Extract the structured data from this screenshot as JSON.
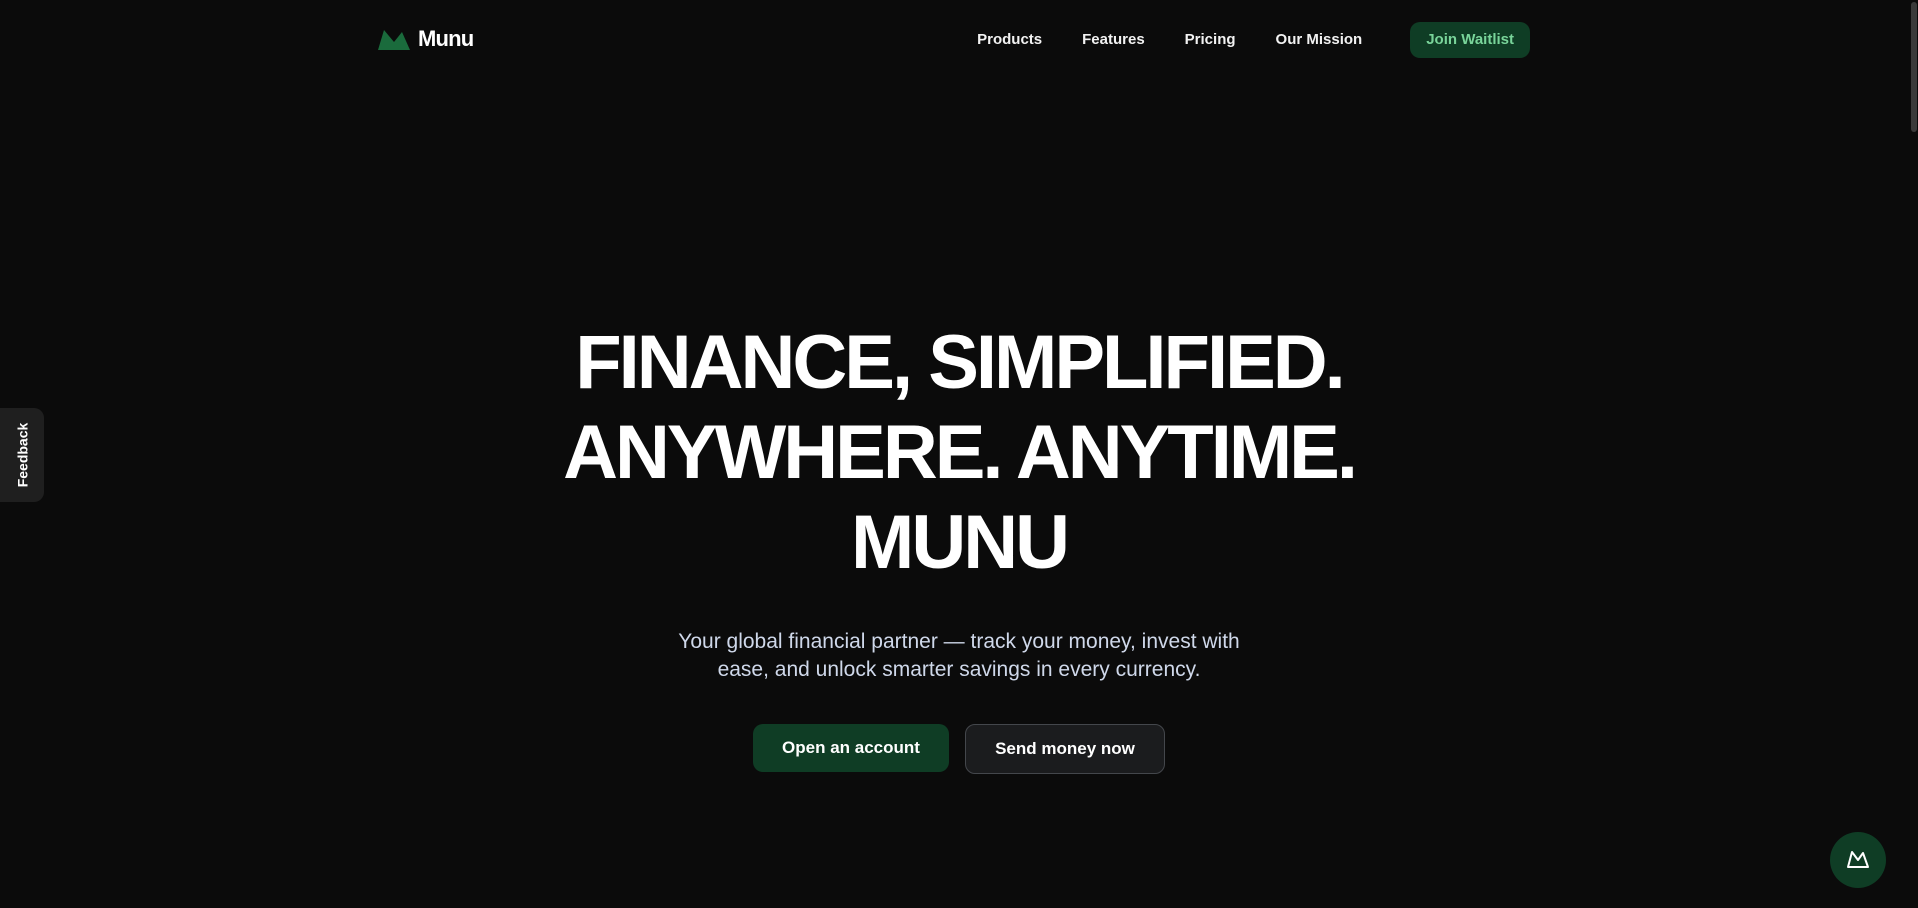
{
  "brand": {
    "name": "Munu",
    "accent": "#0f3d25",
    "accent_text": "#79d49a",
    "logo_icon": "mountain-logo-icon"
  },
  "nav": {
    "items": [
      {
        "label": "Products"
      },
      {
        "label": "Features"
      },
      {
        "label": "Pricing"
      },
      {
        "label": "Our Mission"
      }
    ],
    "cta_label": "Join Waitlist"
  },
  "hero": {
    "title_lines": [
      "FINANCE, SIMPLIFIED.",
      "ANYWHERE. ANYTIME.",
      "MUNU"
    ],
    "subtitle": "Your global financial partner — track your money, invest with ease, and unlock smarter savings in every currency.",
    "primary_cta": "Open an account",
    "secondary_cta": "Send money now"
  },
  "feedback": {
    "label": "Feedback"
  },
  "chat": {
    "icon": "mountain-chat-icon"
  },
  "colors": {
    "background": "#0b0b0b",
    "subtitle_text": "#cfd8ea"
  }
}
